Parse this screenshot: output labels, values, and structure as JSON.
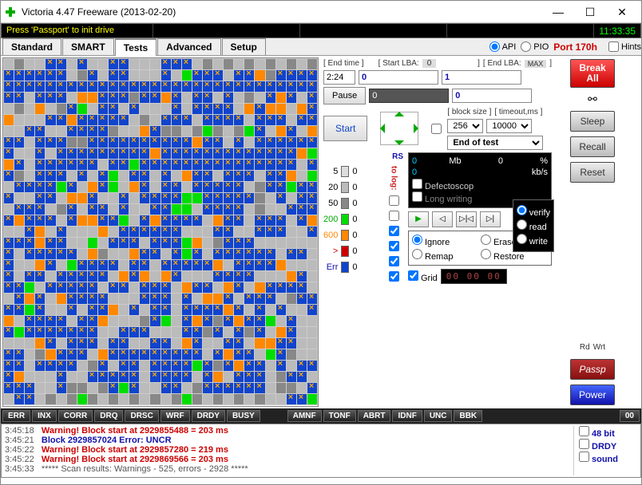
{
  "window": {
    "title": "Victoria 4.47  Freeware (2013-02-20)"
  },
  "status": {
    "msg": "Press 'Passport' to init drive",
    "clock": "11:33:35"
  },
  "tabs": {
    "standard": "Standard",
    "smart": "SMART",
    "tests": "Tests",
    "advanced": "Advanced",
    "setup": "Setup"
  },
  "topopts": {
    "api": "API",
    "pio": "PIO",
    "port": "Port 170h",
    "hints": "Hints"
  },
  "controls": {
    "end_time_lbl": "[ End time ]",
    "start_lba_lbl": "[ Start LBA:",
    "start_lba_lblv": "0",
    "end_lba_lbl": "[ End LBA:",
    "max_lbl": "MAX",
    "end_time_val": "2:24",
    "start_lba_val": "0",
    "end_lba_val": "1",
    "field2_val": "0",
    "field3_val": "0",
    "pause": "Pause",
    "start": "Start",
    "block_size_lbl": "[ block size ]",
    "timeout_lbl": "[ timeout,ms ]",
    "block_size": "256",
    "timeout": "10000",
    "endtest": "End of test"
  },
  "legend": {
    "l5": "5",
    "l20": "20",
    "l50": "50",
    "l200": "200",
    "l600": "600",
    "lgt": ">",
    "lerr": "Err",
    "v5": "0",
    "v20": "0",
    "v50": "0",
    "v200": "0",
    "v600": "0",
    "vgt": "0",
    "verr": "0",
    "rs": "RS",
    "tolog": "to log:"
  },
  "stats": {
    "mb_lbl": "Mb",
    "mb_val": "0",
    "pct_val": "0",
    "pct_lbl": "%",
    "kbs_lbl": "kb/s",
    "kbs_val": "0",
    "verify": "verify",
    "read": "read",
    "write": "write",
    "defscop": "Defectoscop",
    "longwr": "Long writing"
  },
  "actions": {
    "ignore": "Ignore",
    "erase": "Erase",
    "remap": "Remap",
    "restore": "Restore"
  },
  "grid": {
    "label": "Grid",
    "timer": "00 00 00"
  },
  "right": {
    "break_all": "Break\nAll",
    "sleep": "Sleep",
    "recall": "Recall",
    "reset": "Reset",
    "rd": "Rd",
    "wrt": "Wrt",
    "passp": "Passp",
    "power": "Power",
    "n00": "00"
  },
  "bottomstatus": [
    "ERR",
    "INX",
    "CORR",
    "DRQ",
    "DRSC",
    "WRF",
    "DRDY",
    "BUSY",
    "",
    "AMNF",
    "TONF",
    "ABRT",
    "IDNF",
    "UNC",
    "BBK"
  ],
  "log": {
    "lines": [
      {
        "t": "3:45:18",
        "cls": "red",
        "txt": "Warning! Block start at 2929855488 = 203 ms"
      },
      {
        "t": "3:45:21",
        "cls": "blue",
        "txt": "Block 2929857024 Error: UNCR"
      },
      {
        "t": "3:45:22",
        "cls": "red",
        "txt": "Warning! Block start at 2929857280 = 219 ms"
      },
      {
        "t": "3:45:22",
        "cls": "red",
        "txt": "Warning! Block start at 2929869566 = 203 ms"
      },
      {
        "t": "3:45:33",
        "cls": "gray",
        "txt": "***** Scan results: Warnings - 525, errors - 2928 *****"
      }
    ],
    "side": {
      "48bit": "48 bit",
      "drdy": "DRDY",
      "sound": "sound"
    }
  }
}
